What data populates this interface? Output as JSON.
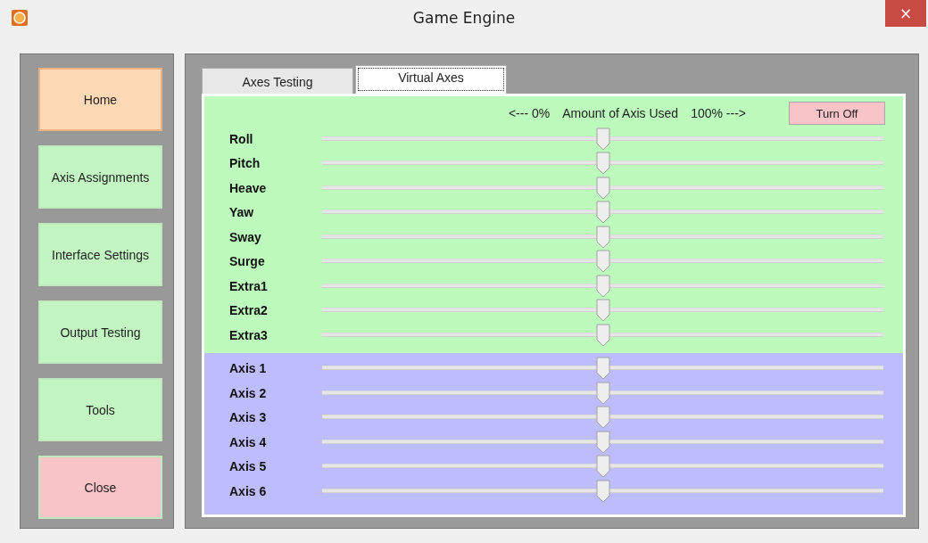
{
  "window": {
    "title": "Game Engine",
    "close": "×"
  },
  "sidebar": {
    "items": [
      {
        "label": "Home",
        "color": "#fdd9b5",
        "selected": true
      },
      {
        "label": "Axis Assignments",
        "color": "#c2f5c2",
        "selected": false
      },
      {
        "label": "Interface Settings",
        "color": "#c2f5c2",
        "selected": false
      },
      {
        "label": "Output Testing",
        "color": "#c2f5c2",
        "selected": false
      },
      {
        "label": "Tools",
        "color": "#c2f5c2",
        "selected": false
      },
      {
        "label": "Close",
        "color": "#f9c4c8",
        "selected": false
      }
    ]
  },
  "tabs": [
    {
      "label": "Axes Testing",
      "selected": false
    },
    {
      "label": "Virtual Axes",
      "selected": true
    }
  ],
  "header": {
    "left": "<--- 0%",
    "middle": "Amount of Axis Used",
    "right": "100% --->",
    "button": "Turn Off"
  },
  "groups": [
    {
      "color": "#bdfbbd",
      "sliders": [
        {
          "label": "Roll",
          "level": 0.5
        },
        {
          "label": "Pitch",
          "level": 0.5
        },
        {
          "label": "Heave",
          "level": 0.5
        },
        {
          "label": "Yaw",
          "level": 0.5
        },
        {
          "label": "Sway",
          "level": 0.5
        },
        {
          "label": "Surge",
          "level": 0.5
        },
        {
          "label": "Extra1",
          "level": 0.5
        },
        {
          "label": "Extra2",
          "level": 0.5
        },
        {
          "label": "Extra3",
          "level": 0.5
        }
      ]
    },
    {
      "color": "#bdbdfb",
      "sliders": [
        {
          "label": "Axis 1",
          "level": 0.5
        },
        {
          "label": "Axis 2",
          "level": 0.5
        },
        {
          "label": "Axis 3",
          "level": 0.5
        },
        {
          "label": "Axis 4",
          "level": 0.5
        },
        {
          "label": "Axis 5",
          "level": 0.5
        },
        {
          "label": "Axis 6",
          "level": 0.5
        }
      ]
    }
  ]
}
